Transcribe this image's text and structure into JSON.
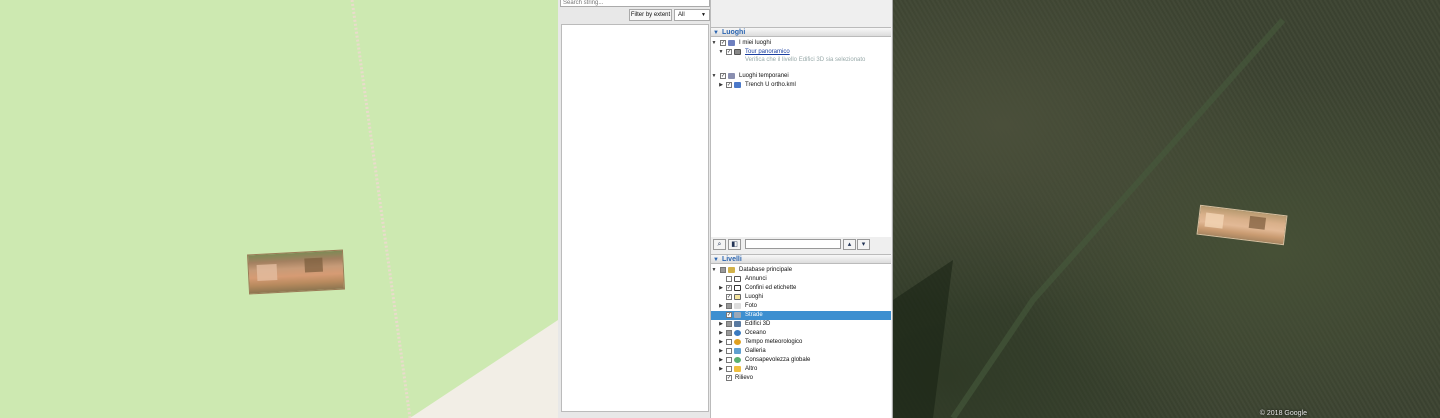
{
  "search": {
    "placeholder": "Search string..."
  },
  "filter": {
    "button_label": "Filter by extent",
    "select_value": "All"
  },
  "places": {
    "header": "Luoghi",
    "items": [
      {
        "label": "I miei luoghi",
        "checked": true,
        "icon": "folder-icon"
      },
      {
        "label": "Tour panoramico",
        "checked": true,
        "icon": "tour-icon"
      },
      {
        "label": "Verifica che il livello Edifici 3D sia selezionato"
      },
      {
        "label": "Luoghi temporanei",
        "checked": true,
        "icon": "folder-icon"
      },
      {
        "label": "Trench U ortho.kml",
        "checked": true,
        "icon": "kml-layer-icon"
      }
    ]
  },
  "layers": {
    "header": "Livelli",
    "items": [
      {
        "label": "Database principale",
        "icon": "database-icon"
      },
      {
        "label": "Annunci",
        "checked": false,
        "icon": "announcement-icon"
      },
      {
        "label": "Confini ed etichette",
        "checked": true,
        "icon": "borders-icon"
      },
      {
        "label": "Luoghi",
        "checked": true,
        "icon": "places-icon"
      },
      {
        "label": "Foto",
        "checked": false,
        "icon": "photo-icon"
      },
      {
        "label": "Strade",
        "checked": true,
        "icon": "roads-icon",
        "selected": true
      },
      {
        "label": "Edifici 3D",
        "checked": false,
        "icon": "buildings-3d-icon"
      },
      {
        "label": "Oceano",
        "checked": false,
        "icon": "ocean-icon"
      },
      {
        "label": "Tempo meteorologico",
        "checked": false,
        "icon": "weather-icon"
      },
      {
        "label": "Galleria",
        "checked": false,
        "icon": "gallery-icon"
      },
      {
        "label": "Consapevolezza globale",
        "checked": false,
        "icon": "global-awareness-icon"
      },
      {
        "label": "Altro",
        "checked": false,
        "icon": "other-icon"
      },
      {
        "label": "Rilievo",
        "checked": true,
        "icon": "terrain-icon"
      }
    ]
  },
  "map": {
    "copyright": "© 2018 Google"
  },
  "colors": {
    "map_green": "#cde9b1",
    "selection_blue": "#3d8fd0",
    "header_blue": "#2a64b0"
  }
}
